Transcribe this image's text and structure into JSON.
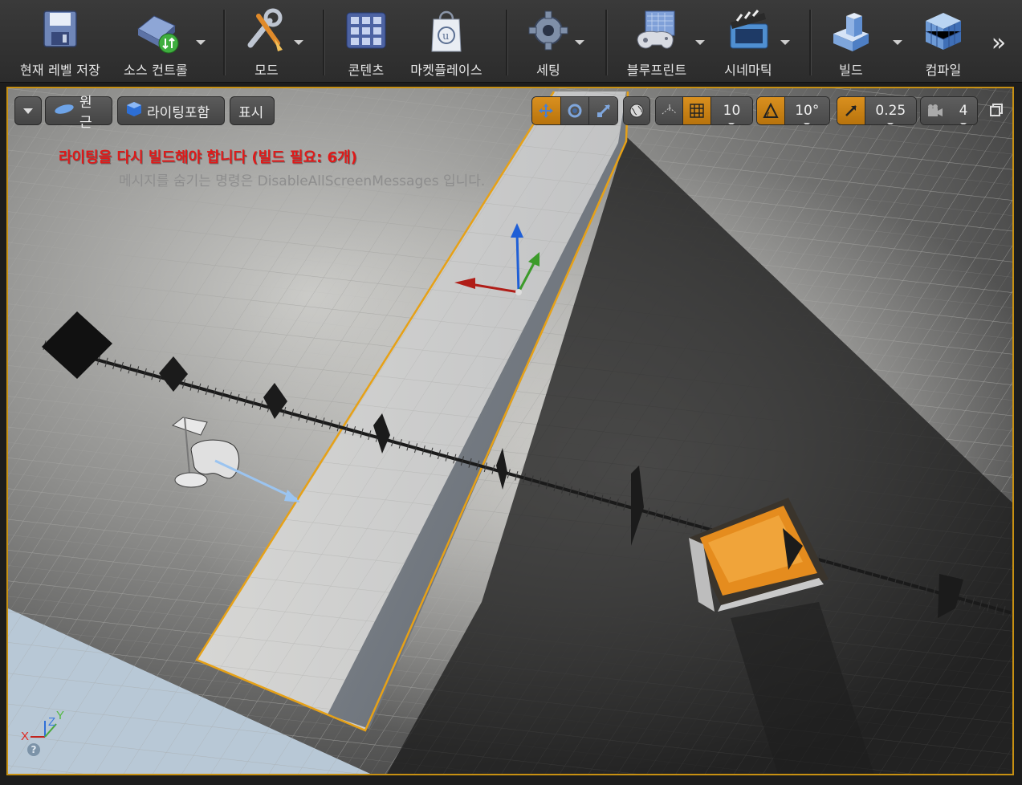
{
  "toolbar": {
    "save": "현재 레벨 저장",
    "source_control": "소스 컨트롤",
    "modes": "모드",
    "content": "콘텐츠",
    "marketplace": "마켓플레이스",
    "settings": "세팅",
    "blueprints": "블루프린트",
    "cinematics": "시네마틱",
    "build": "빌드",
    "compile": "컴파일",
    "more": "»"
  },
  "viewport": {
    "perspective": "원근",
    "view_mode": "라이팅포함",
    "show": "표시",
    "grid_snap": "10",
    "rotation_snap": "10°",
    "scale_snap": "0.25",
    "camera_speed": "4",
    "warning": "라이팅을 다시 빌드해야 합니다 (빌드 필요: 6개)",
    "hint": "메시지를 숨기는 명령은 DisableAllScreenMessages 입니다.",
    "axis_x": "X",
    "axis_y": "Y",
    "axis_z": "Z",
    "help": "?"
  },
  "colors": {
    "selection": "#e6a117",
    "warning": "#e01919",
    "active_toggle": "#c8820f"
  }
}
